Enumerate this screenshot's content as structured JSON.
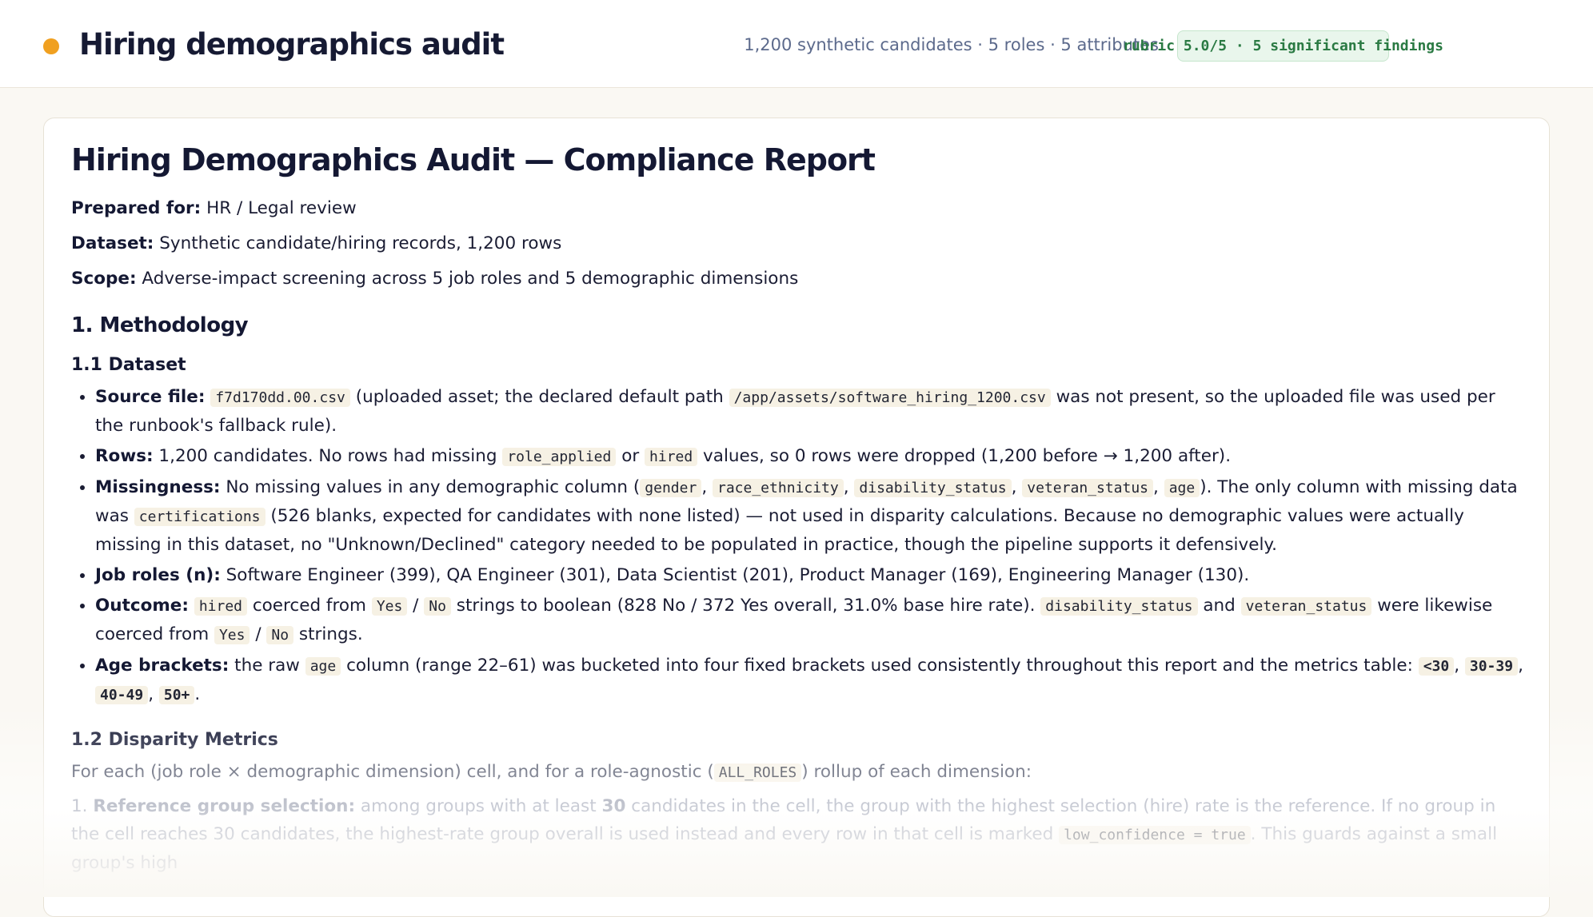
{
  "header": {
    "title": "Hiring demographics audit",
    "meta": "1,200 synthetic candidates · 5 roles · 5 attributes",
    "badge": "rubric 5.0/5 · 5 significant findings"
  },
  "report": {
    "title": "Hiring Demographics Audit — Compliance Report",
    "prepared_for_label": "Prepared for:",
    "prepared_for": " HR / Legal review",
    "dataset_label": "Dataset:",
    "dataset": " Synthetic candidate/hiring records, 1,200 rows",
    "scope_label": "Scope:",
    "scope": " Adverse-impact screening across 5 job roles and 5 demographic dimensions"
  },
  "methodology": {
    "heading": "1. Methodology",
    "dataset_heading": "1.1 Dataset",
    "bullets": {
      "source": {
        "label": "Source file:",
        "file": "f7d170dd.00.csv",
        "t1": " (uploaded asset; the declared default path ",
        "path": "/app/assets/software_hiring_1200.csv",
        "t2": " was not present, so the uploaded file was used per the runbook's fallback rule)."
      },
      "rows": {
        "label": "Rows:",
        "t1": " 1,200 candidates. No rows had missing ",
        "c1": "role_applied",
        "t2": " or ",
        "c2": "hired",
        "t3": " values, so 0 rows were dropped (1,200 before → 1,200 after)."
      },
      "missingness": {
        "label": "Missingness:",
        "t1": " No missing values in any demographic column (",
        "c1": "gender",
        "c2": "race_ethnicity",
        "c3": "disability_status",
        "c4": "veteran_status",
        "c5": "age",
        "t2": "). The only column with missing data was ",
        "c6": "certifications",
        "t3": " (526 blanks, expected for candidates with none listed) — not used in disparity calculations. Because no demographic values were actually missing in this dataset, no \"Unknown/Declined\" category needed to be populated in practice, though the pipeline supports it defensively."
      },
      "roles": {
        "label": "Job roles (n):",
        "text": " Software Engineer (399), QA Engineer (301), Data Scientist (201), Product Manager (169), Engineering Manager (130)."
      },
      "outcome": {
        "label": "Outcome:",
        "c1": "hired",
        "t1": " coerced from ",
        "c2": "Yes",
        "c3": "No",
        "t2": " strings to boolean (828 No / 372 Yes overall, 31.0% base hire rate). ",
        "c4": "disability_status",
        "t3": " and ",
        "c5": "veteran_status",
        "t4": " were likewise coerced from ",
        "c6": "Yes",
        "c7": "No",
        "t5": " strings."
      },
      "age": {
        "label": "Age brackets:",
        "t1": " the raw ",
        "c1": "age",
        "t2": " column (range 22–61) was bucketed into four fixed brackets used consistently throughout this report and the metrics table: ",
        "b1": "<30",
        "b2": "30-39",
        "b3": "40-49",
        "b4": "50+"
      }
    },
    "metrics_heading": "1.2 Disparity Metrics",
    "metrics_intro_1": "For each (job role × demographic dimension) cell, and for a role-agnostic (",
    "metrics_intro_code": "ALL_ROLES",
    "metrics_intro_2": ") rollup of each dimension:",
    "step1": {
      "num": "1. ",
      "label": "Reference group selection:",
      "t1": " among groups with at least ",
      "threshold": "30",
      "t2": " candidates in the cell, the group with the highest selection (hire) rate is the reference. If no group in the cell reaches 30 candidates, the highest-rate group overall is used instead and every row in that cell is marked ",
      "code": "low_confidence = true",
      "t3": ". This guards against a small group's high"
    }
  }
}
